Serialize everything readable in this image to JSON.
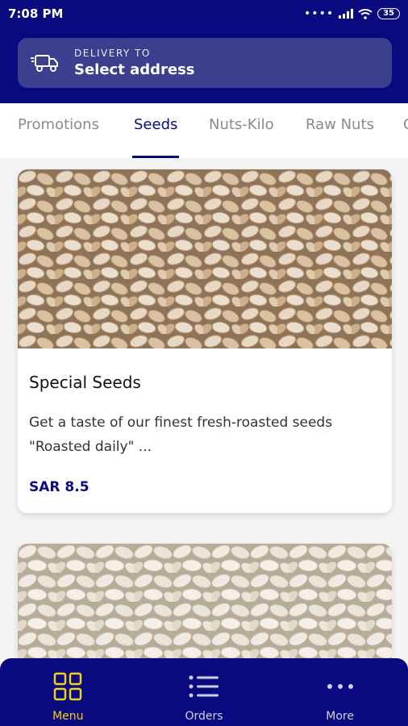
{
  "status_bar": {
    "time": "7:08 PM",
    "battery": "35"
  },
  "delivery": {
    "label": "DELIVERY TO",
    "value": "Select address"
  },
  "tabs": [
    {
      "label": "Promotions",
      "active": false
    },
    {
      "label": "Seeds",
      "active": true
    },
    {
      "label": "Nuts-Kilo",
      "active": false
    },
    {
      "label": "Raw Nuts",
      "active": false
    },
    {
      "label": "C",
      "active": false
    }
  ],
  "products": [
    {
      "title": "Special Seeds",
      "description": "Get a taste of our finest fresh-roasted seeds \"Roasted daily\" ...",
      "price": "SAR 8.5",
      "image": "roasted-seeds-photo"
    },
    {
      "image": "white-seeds-photo"
    }
  ],
  "bottom_nav": [
    {
      "label": "Menu",
      "icon": "grid-icon",
      "active": true
    },
    {
      "label": "Orders",
      "icon": "list-icon",
      "active": false
    },
    {
      "label": "More",
      "icon": "more-dots-icon",
      "active": false
    }
  ],
  "colors": {
    "primary": "#0a0a80",
    "accent": "#f2d31b",
    "card_bg": "#ffffff",
    "delivery_card": "#3b3f8e"
  }
}
